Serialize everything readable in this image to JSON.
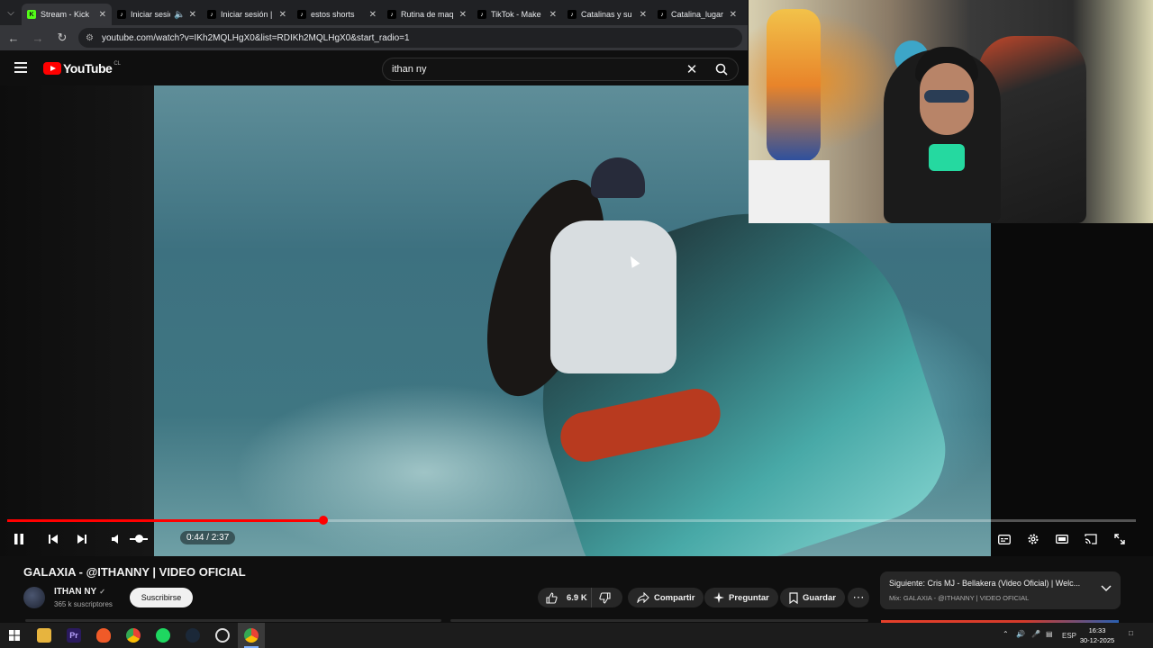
{
  "browser": {
    "tabs": [
      {
        "title": "Stream - Kick"
      },
      {
        "title": "Iniciar sesió"
      },
      {
        "title": "Iniciar sesión |"
      },
      {
        "title": "estos shorts"
      },
      {
        "title": "Rutina de maq"
      },
      {
        "title": "TikTok - Make"
      },
      {
        "title": "Catalinas y su"
      },
      {
        "title": "Catalina_lugar"
      }
    ],
    "url": "youtube.com/watch?v=IKh2MQLHgX0&list=RDIKh2MQLHgX0&start_radio=1"
  },
  "youtube": {
    "logo_text": "YouTube",
    "country_code": "CL",
    "search_value": "ithan ny"
  },
  "player": {
    "time_display": "0:44 / 2:37",
    "progress": 0.28,
    "volume": 0.5
  },
  "video": {
    "title": "GALAXIA - @ITHANNY | VIDEO OFICIAL",
    "channel_name": "ITHAN NY",
    "subscribers": "365 k suscriptores",
    "subscribe_label": "Suscribirse",
    "likes": "6.9 K",
    "share_label": "Compartir",
    "ask_label": "Preguntar",
    "save_label": "Guardar"
  },
  "next_up": {
    "title": "Siguiente: Cris MJ - Bellakera (Video Oficial) | Welc...",
    "subtitle": "Mix: GALAXIA - @ITHANNY | VIDEO OFICIAL"
  },
  "taskbar": {
    "language": "ESP",
    "time": "16:33",
    "date": "30-12-2025"
  },
  "colors": {
    "accent_red": "#ff0000",
    "background": "#0f0f0f",
    "pill": "#272727"
  }
}
